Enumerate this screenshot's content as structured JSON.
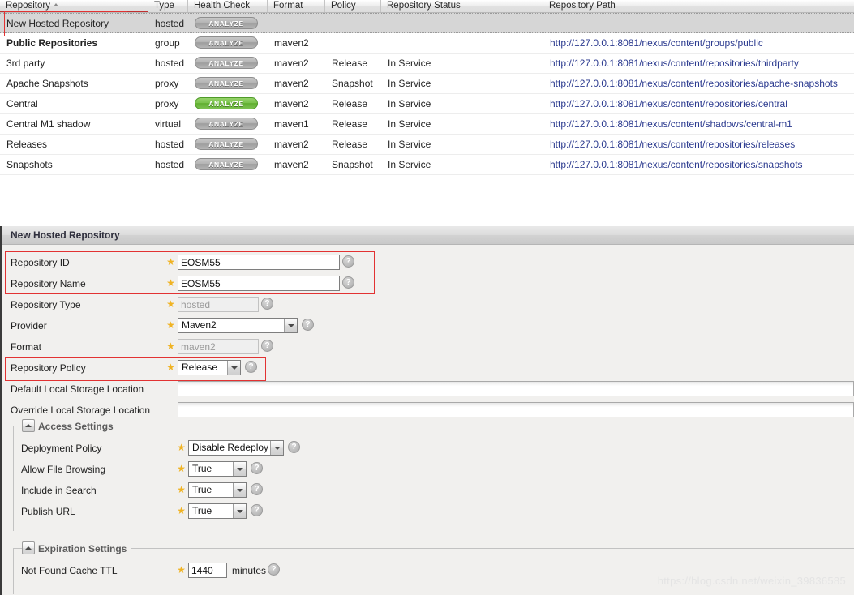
{
  "grid": {
    "columns": [
      {
        "label": "Repository",
        "sorted": true,
        "sort_dir": "asc"
      },
      {
        "label": "Type"
      },
      {
        "label": "Health Check"
      },
      {
        "label": "Format"
      },
      {
        "label": "Policy"
      },
      {
        "label": "Repository Status"
      },
      {
        "label": "Repository Path"
      }
    ],
    "analyze_label": "ANALYZE",
    "rows": [
      {
        "repository": "New Hosted Repository",
        "type": "hosted",
        "health": "grey",
        "format": "",
        "policy": "",
        "status": "",
        "path": "",
        "selected": true,
        "bold": false
      },
      {
        "repository": "Public Repositories",
        "type": "group",
        "health": "grey",
        "format": "maven2",
        "policy": "",
        "status": "",
        "path": "http://127.0.0.1:8081/nexus/content/groups/public",
        "selected": false,
        "bold": true
      },
      {
        "repository": "3rd party",
        "type": "hosted",
        "health": "grey",
        "format": "maven2",
        "policy": "Release",
        "status": "In Service",
        "path": "http://127.0.0.1:8081/nexus/content/repositories/thirdparty",
        "selected": false,
        "bold": false
      },
      {
        "repository": "Apache Snapshots",
        "type": "proxy",
        "health": "grey",
        "format": "maven2",
        "policy": "Snapshot",
        "status": "In Service",
        "path": "http://127.0.0.1:8081/nexus/content/repositories/apache-snapshots",
        "selected": false,
        "bold": false
      },
      {
        "repository": "Central",
        "type": "proxy",
        "health": "green",
        "format": "maven2",
        "policy": "Release",
        "status": "In Service",
        "path": "http://127.0.0.1:8081/nexus/content/repositories/central",
        "selected": false,
        "bold": false
      },
      {
        "repository": "Central M1 shadow",
        "type": "virtual",
        "health": "grey",
        "format": "maven1",
        "policy": "Release",
        "status": "In Service",
        "path": "http://127.0.0.1:8081/nexus/content/shadows/central-m1",
        "selected": false,
        "bold": false
      },
      {
        "repository": "Releases",
        "type": "hosted",
        "health": "grey",
        "format": "maven2",
        "policy": "Release",
        "status": "In Service",
        "path": "http://127.0.0.1:8081/nexus/content/repositories/releases",
        "selected": false,
        "bold": false
      },
      {
        "repository": "Snapshots",
        "type": "hosted",
        "health": "grey",
        "format": "maven2",
        "policy": "Snapshot",
        "status": "In Service",
        "path": "http://127.0.0.1:8081/nexus/content/repositories/snapshots",
        "selected": false,
        "bold": false
      }
    ]
  },
  "form": {
    "title": "New Hosted Repository",
    "help_glyph": "?",
    "star_glyph": "★",
    "fields": {
      "repository_id": {
        "label": "Repository ID",
        "value": "EOSM55",
        "required": true
      },
      "repository_name": {
        "label": "Repository Name",
        "value": "EOSM55",
        "required": true
      },
      "repository_type": {
        "label": "Repository Type",
        "value": "hosted",
        "required": true,
        "readonly": true
      },
      "provider": {
        "label": "Provider",
        "value": "Maven2",
        "required": true
      },
      "format": {
        "label": "Format",
        "value": "maven2",
        "required": true,
        "readonly": true
      },
      "repository_policy": {
        "label": "Repository Policy",
        "value": "Release",
        "required": true
      },
      "default_local_storage": {
        "label": "Default Local Storage Location",
        "value": "",
        "required": false
      },
      "override_local_storage": {
        "label": "Override Local Storage Location",
        "value": "",
        "required": false
      }
    },
    "access_settings": {
      "legend": "Access Settings",
      "deployment_policy": {
        "label": "Deployment Policy",
        "value": "Disable Redeploy",
        "required": true
      },
      "allow_file_browsing": {
        "label": "Allow File Browsing",
        "value": "True",
        "required": true
      },
      "include_in_search": {
        "label": "Include in Search",
        "value": "True",
        "required": true
      },
      "publish_url": {
        "label": "Publish URL",
        "value": "True",
        "required": true
      }
    },
    "expiration_settings": {
      "legend": "Expiration Settings",
      "not_found_cache_ttl": {
        "label": "Not Found Cache TTL",
        "value": "1440",
        "unit": "minutes",
        "required": true
      }
    }
  },
  "watermark": "https://blog.csdn.net/weixin_39836585"
}
